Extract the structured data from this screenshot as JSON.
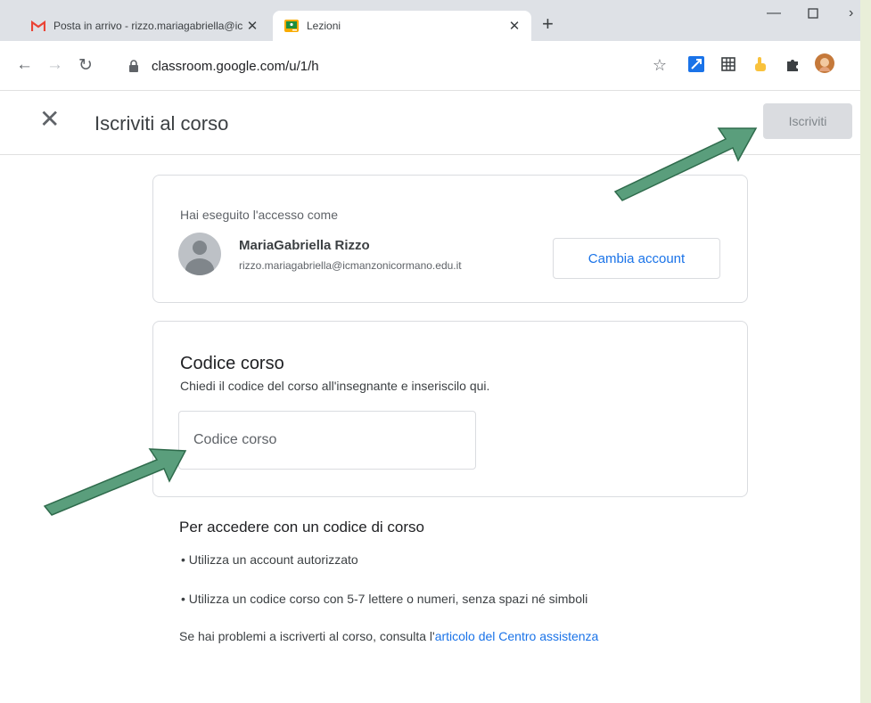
{
  "browser": {
    "tabs": [
      {
        "label": "Posta in arrivo - rizzo.mariagabriella@icmanzonicormano.edu.it",
        "icon": "gmail-icon",
        "active": false
      },
      {
        "label": "Lezioni",
        "icon": "classroom-icon",
        "active": true
      }
    ],
    "new_tab": "+",
    "close_tab": "✕",
    "url": "classroom.google.com/u/1/h"
  },
  "header": {
    "title": "Iscriviti al corso",
    "enroll_label": "Iscriviti"
  },
  "account": {
    "signed_in_label": "Hai eseguito l'accesso come",
    "name": "MariaGabriella Rizzo",
    "email": "rizzo.mariagabriella@icmanzonicormano.edu.it",
    "switch_label": "Cambia account"
  },
  "course_code": {
    "title": "Codice corso",
    "hint": "Chiedi il codice del corso all'insegnante e inseriscilo qui.",
    "placeholder": "Codice corso"
  },
  "instructions": {
    "heading": "Per accedere con un codice di corso",
    "bullets": [
      "• Utilizza un account autorizzato",
      "• Utilizza un codice corso con 5-7 lettere o numeri, senza spazi né simboli"
    ],
    "help_prefix": "Se hai problemi a iscriverti al corso, consulta l'",
    "help_link": "articolo del Centro assistenza"
  },
  "colors": {
    "accent": "#1a73e8",
    "arrow": "#5a9e7c",
    "tabstrip": "#dee1e6"
  }
}
